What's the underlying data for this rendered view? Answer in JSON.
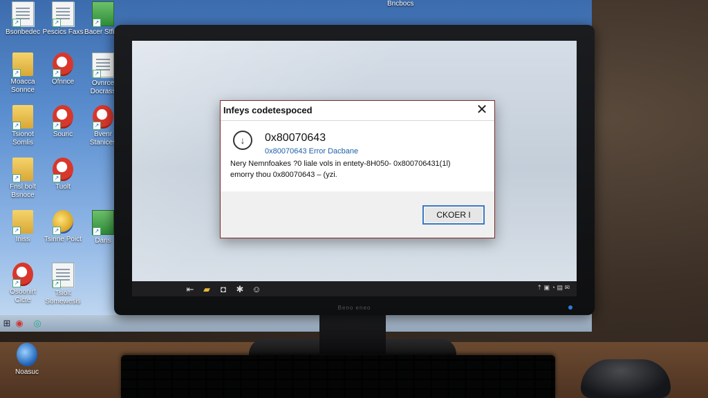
{
  "desktop": {
    "icons": [
      {
        "label": "Bsonbedec",
        "kind": "doc"
      },
      {
        "label": "Pescics Faxs",
        "kind": "doc"
      },
      {
        "label": "Bacer Stfies",
        "kind": "green"
      },
      {
        "label": "Moacca Sonnce",
        "kind": "folder"
      },
      {
        "label": "Ofnnce",
        "kind": "red"
      },
      {
        "label": "Ovnrce Docrass",
        "kind": "doc"
      },
      {
        "label": "Tsionot Somlis",
        "kind": "folder"
      },
      {
        "label": "Souric",
        "kind": "red"
      },
      {
        "label": "Bvenr Stanices",
        "kind": "red"
      },
      {
        "label": "Fnsl bolt Bsnoce",
        "kind": "folder"
      },
      {
        "label": "Tuolt",
        "kind": "red"
      },
      {
        "label": "Iniss",
        "kind": "folder"
      },
      {
        "label": "Tsinne Poict",
        "kind": "yellow"
      },
      {
        "label": "Dans",
        "kind": "green"
      },
      {
        "label": "Osoonirt Cicte",
        "kind": "red"
      },
      {
        "label": "Tsiolt Somewesis",
        "kind": "doc"
      }
    ],
    "bottom_icon_label": "Noasuc",
    "top_label": "Bncbocs"
  },
  "monitor": {
    "brand": "Beno eneo"
  },
  "dialog": {
    "title": "Infeys codetespoced",
    "close_glyph": "✕",
    "error_code": "0x80070643",
    "error_subtitle": "0x80070643 Error Dacbane",
    "message_line1": "Nery Nemnfoakes ?0 liale vols in entety-8H050- 0x800706431(1l)",
    "message_line2": "emorry thou 0x80070643 – (yzi.",
    "ok_button": "CKOER I"
  },
  "colors": {
    "dialog_border": "#7d2b25",
    "ok_focus": "#3a78c3",
    "link_blue": "#1d5fa8"
  }
}
